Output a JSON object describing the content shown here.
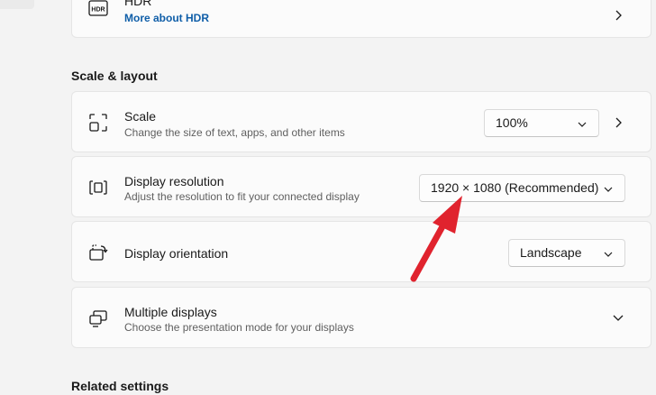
{
  "hdr": {
    "title": "HDR",
    "link": "More about HDR"
  },
  "sections": {
    "scale_layout": "Scale & layout",
    "related_settings": "Related settings"
  },
  "scale": {
    "title": "Scale",
    "subtitle": "Change the size of text, apps, and other items",
    "value": "100%"
  },
  "resolution": {
    "title": "Display resolution",
    "subtitle": "Adjust the resolution to fit your connected display",
    "value": "1920 × 1080 (Recommended)"
  },
  "orientation": {
    "title": "Display orientation",
    "value": "Landscape"
  },
  "multiple": {
    "title": "Multiple displays",
    "subtitle": "Choose the presentation mode for your displays"
  },
  "annotation": {
    "color": "#e0232e"
  },
  "icons": {
    "hdr": "hdr-icon",
    "scale": "scale-icon",
    "resolution": "resolution-icon",
    "orientation": "orientation-icon",
    "multiple": "multiple-displays-icon"
  }
}
